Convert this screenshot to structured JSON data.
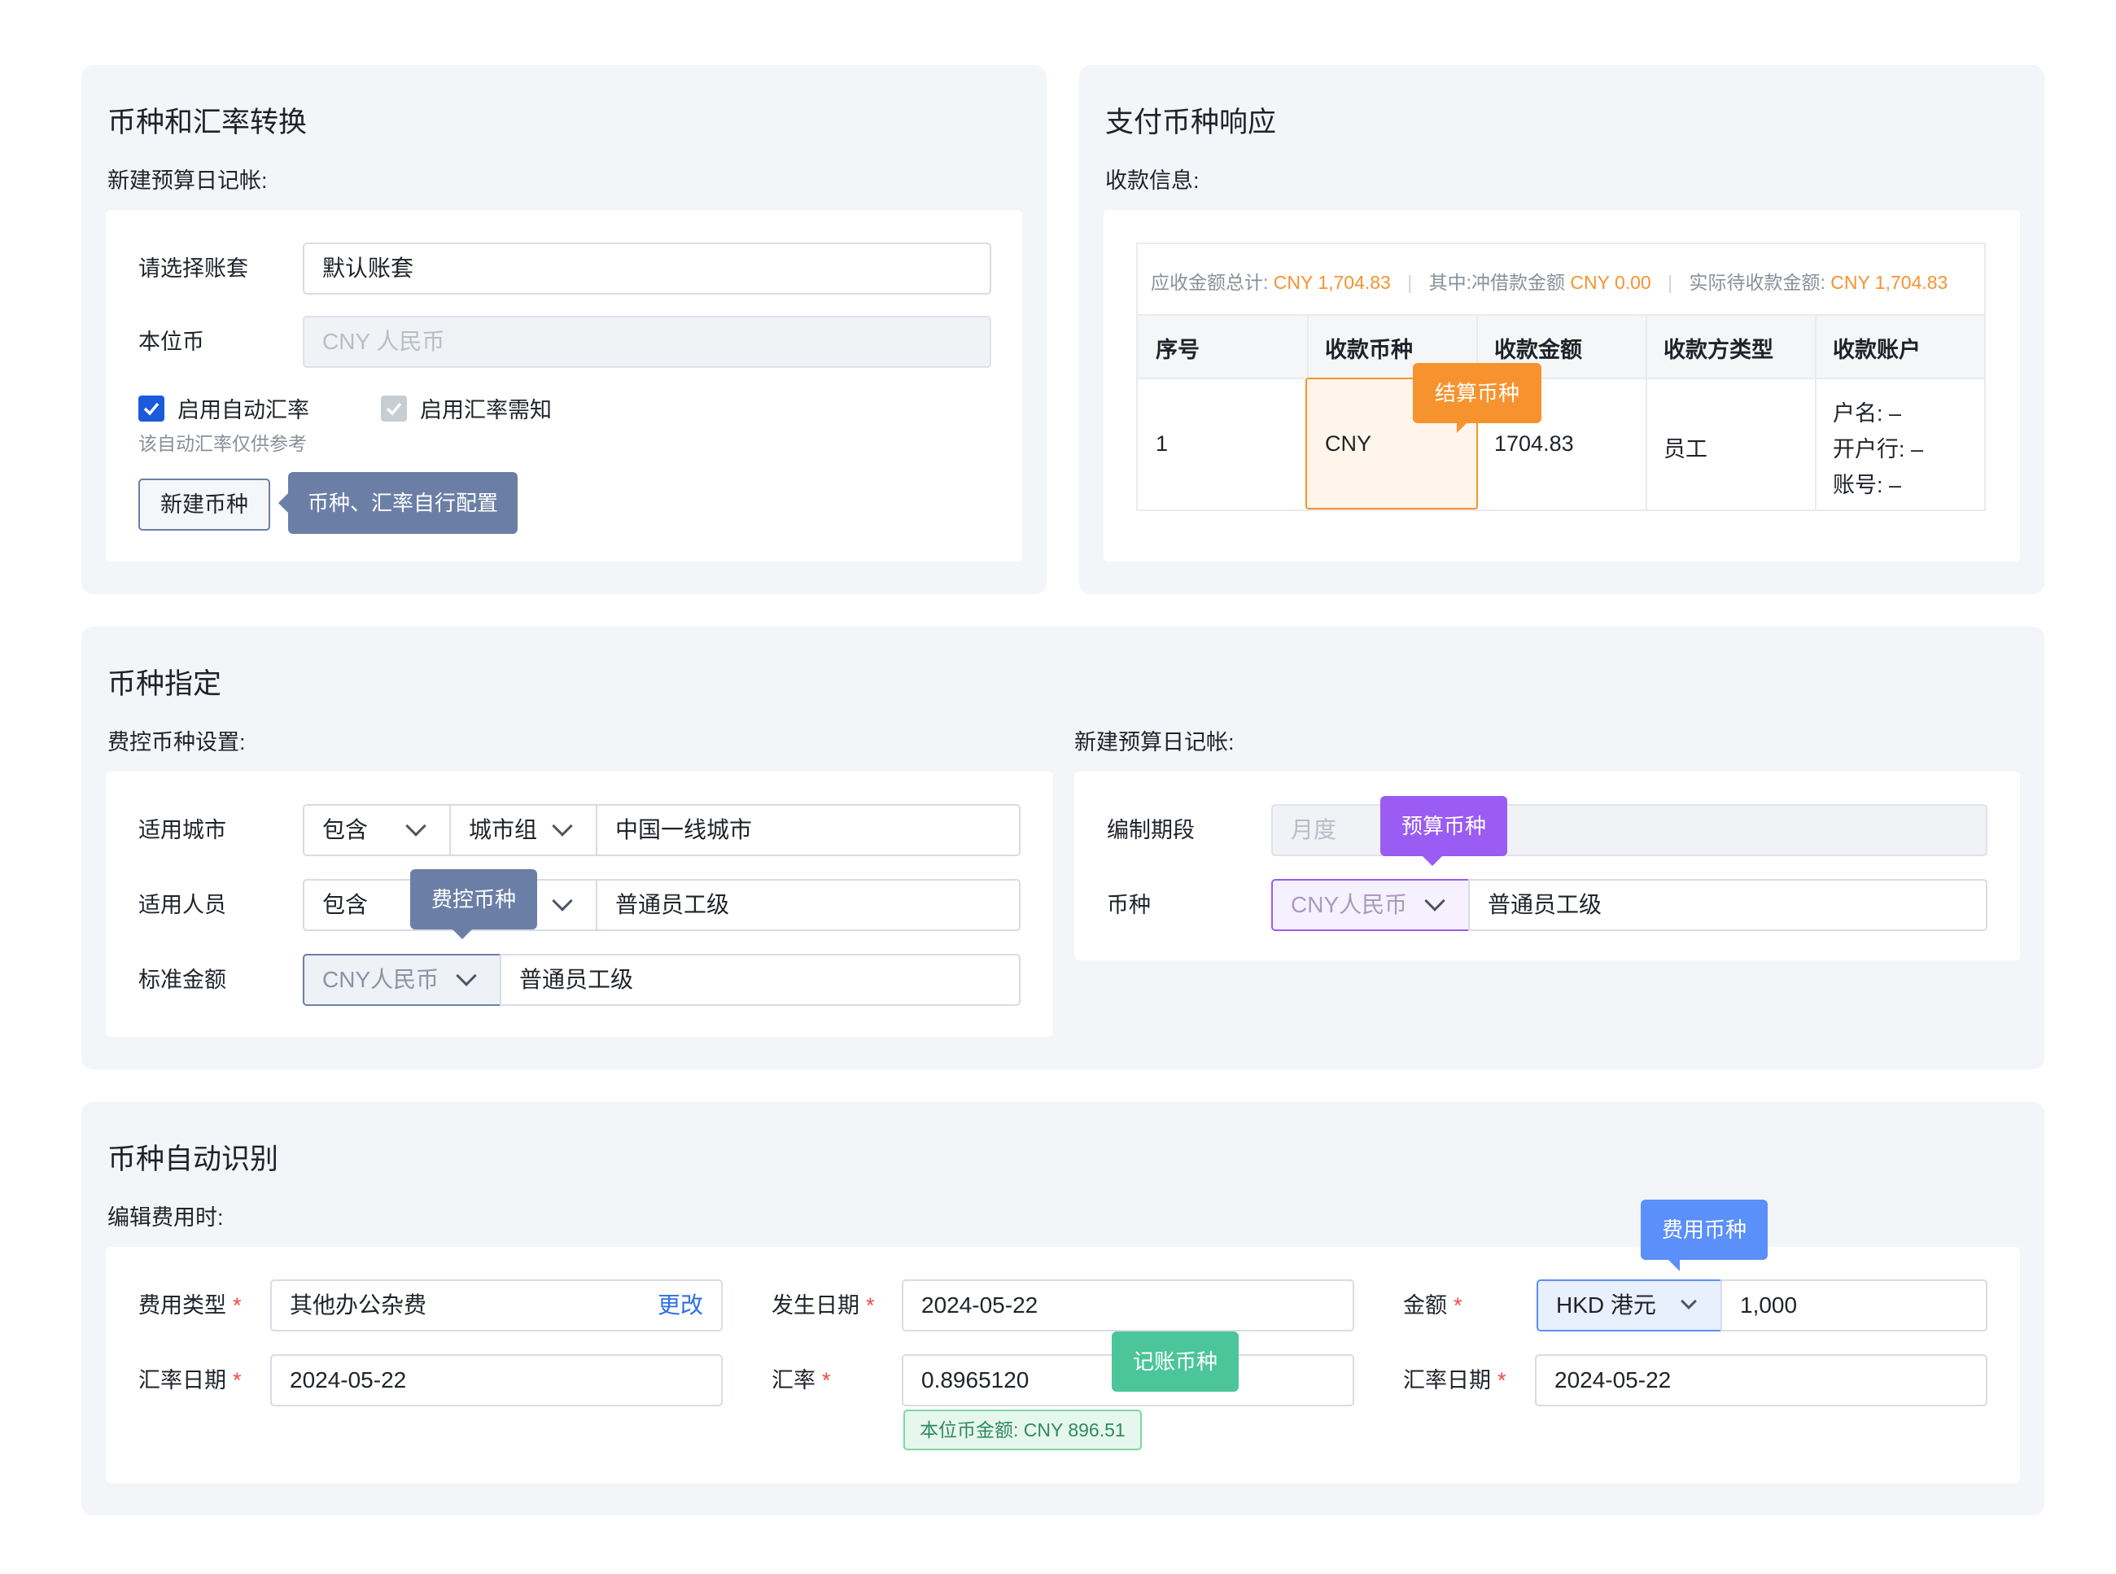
{
  "section_currency": {
    "title": "币种和汇率转换",
    "subtitle": "新建预算日记帐:",
    "account_set_label": "请选择账套",
    "account_set_value": "默认账套",
    "base_currency_label": "本位币",
    "base_currency_value": "CNY 人民币",
    "auto_rate_label": "启用自动汇率",
    "auto_rate_hint": "该自动汇率仅供参考",
    "rate_notice_label": "启用汇率需知",
    "new_currency_button": "新建币种",
    "config_tip": "币种、汇率自行配置"
  },
  "section_payment": {
    "title": "支付币种响应",
    "subtitle": "收款信息:",
    "summary": {
      "total_label": "应收金额总计: ",
      "total_value": "CNY 1,704.83",
      "offset_label": "其中:冲借款金额 ",
      "offset_value": "CNY 0.00",
      "actual_label": "实际待收款金额: ",
      "actual_value": "CNY 1,704.83"
    },
    "columns": [
      "序号",
      "收款币种",
      "收款金额",
      "收款方类型",
      "收款账户"
    ],
    "row": {
      "index": "1",
      "currency": "CNY",
      "amount": "1704.83",
      "payee_type": "员工",
      "account_lines": [
        "户名: –",
        "开户行: –",
        "账号: –"
      ]
    },
    "settle_tip": "结算币种"
  },
  "section_assign": {
    "title": "币种指定",
    "left_subtitle": "费控币种设置:",
    "city_label": "适用城市",
    "city_mode": "包含",
    "city_group": "城市组",
    "city_value": "中国一线城市",
    "person_label": "适用人员",
    "person_mode": "包含",
    "person_value": "普通员工级",
    "control_tip": "费控币种",
    "standard_label": "标准金额",
    "standard_currency": "CNY人民币",
    "standard_value": "普通员工级",
    "right_subtitle": "新建预算日记帐:",
    "period_label": "编制期段",
    "period_value": "月度",
    "budget_tip": "预算币种",
    "currency_label": "币种",
    "currency_value": "CNY人民币",
    "currency_level": "普通员工级"
  },
  "section_auto": {
    "title": "币种自动识别",
    "subtitle": "编辑费用时:",
    "expense_type_label": "费用类型",
    "expense_type_value": "其他办公杂费",
    "change_link": "更改",
    "date_label": "发生日期",
    "date_value": "2024-05-22",
    "amount_label": "金额",
    "amount_currency": "HKD 港元",
    "amount_value": "1,000",
    "expense_tip": "费用币种",
    "rate_date_label": "汇率日期",
    "rate_date_value": "2024-05-22",
    "rate_label": "汇率",
    "rate_value": "0.8965120",
    "booking_tip": "记账币种",
    "base_amount": "本位币金额: CNY 896.51",
    "rate_date2_label": "汇率日期",
    "rate_date2_value": "2024-05-22",
    "required_mark": "*"
  },
  "colors": {
    "orange": "#f7932f",
    "purple": "#9a5cf2",
    "slate": "#6b7fa6",
    "blue": "#5b8ff9",
    "green": "#4cc59b",
    "link": "#2e6fe6",
    "checkbox": "#1a5bdc"
  }
}
